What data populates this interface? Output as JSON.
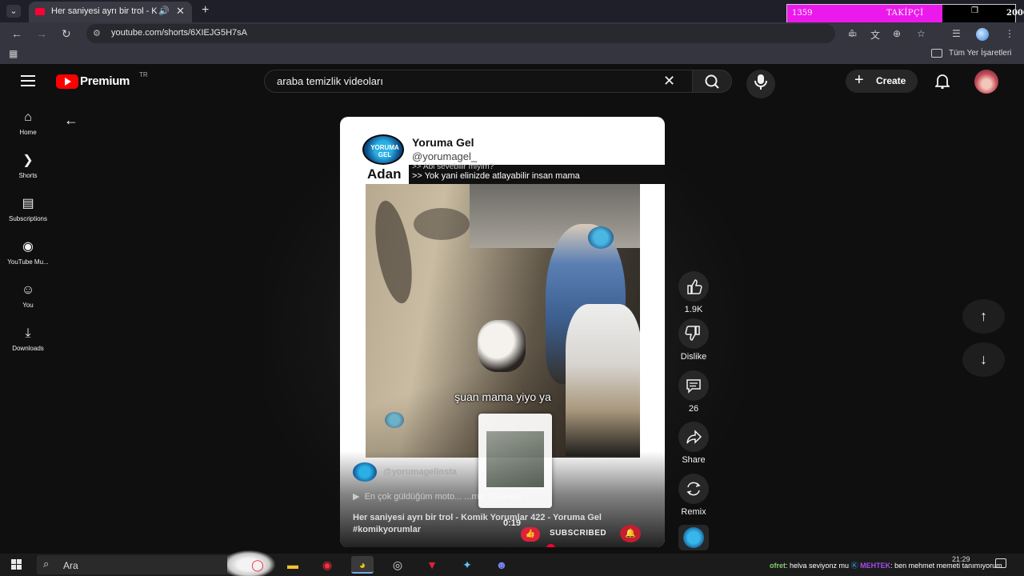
{
  "browser": {
    "tab_title": "Her saniyesi ayrı bir trol - K",
    "url": "youtube.com/shorts/6XIEJG5H7sA",
    "bookmark_folder": "Tüm Yer İşaretleri"
  },
  "overlay": {
    "follower_count": "1359",
    "follower_label": "TAKİPÇİ",
    "follower_goal": "2000",
    "progress_fraction": 0.68
  },
  "youtube": {
    "brand": "Premium",
    "country": "TR",
    "search_query": "araba temizlik videoları",
    "create_label": "Create",
    "sidebar": [
      {
        "label": "Home",
        "icon": "home-icon",
        "glyph": "⌂"
      },
      {
        "label": "Shorts",
        "icon": "shorts-icon",
        "glyph": "❯"
      },
      {
        "label": "Subscriptions",
        "icon": "subscriptions-icon",
        "glyph": "▤"
      },
      {
        "label": "YouTube Mu...",
        "icon": "youtube-music-icon",
        "glyph": "◉"
      },
      {
        "label": "You",
        "icon": "you-icon",
        "glyph": "☺"
      },
      {
        "label": "Downloads",
        "icon": "downloads-icon",
        "glyph": "⤓"
      }
    ]
  },
  "short": {
    "channel_name": "Yoruma Gel",
    "channel_handle": "@yorumagel_",
    "logo_text": "YORUMA GEL",
    "header_partial": "Adan",
    "subtitle_prev": ">> Abi sevebilir miyim?",
    "subtitle_current": ">> Yok yani elinizde atlayabilir insan mama",
    "video_caption": "şuan mama yiyo ya",
    "insta_handle": "@yorumagelinsta",
    "playlist": "En çok güldüğüm moto... ...mik Yorumlar",
    "title": "Her saniyesi ayrı bir trol - Komik Yorumlar 422 - Yoruma Gel",
    "hashtag": "#komikyorumlar",
    "time": "0:19",
    "subscribe_label": "SUBSCRIBED",
    "progress_fraction": 0.65
  },
  "actions": {
    "like_count": "1.9K",
    "dislike_label": "Dislike",
    "comment_count": "26",
    "share_label": "Share",
    "remix_label": "Remix"
  },
  "taskbar": {
    "search_placeholder": "Ara",
    "chat_user1": "ofret",
    "chat_msg1": ": helva seviyonz mu",
    "chat_user2": "MEHTEK",
    "chat_msg2": ": ben mehmet memeti tanımıyorum",
    "time": "21:29"
  }
}
